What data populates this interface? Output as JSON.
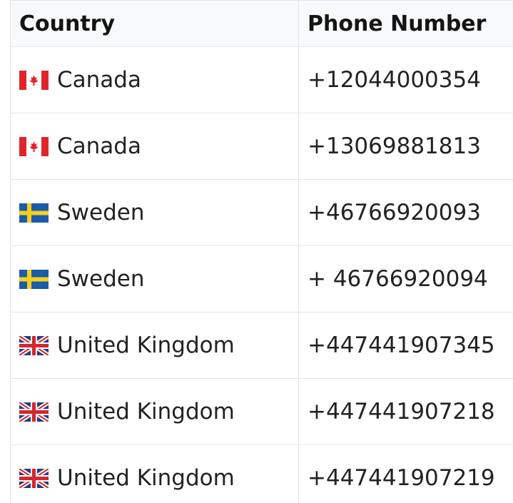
{
  "table": {
    "headers": {
      "country": "Country",
      "phone": "Phone Number"
    },
    "rows": [
      {
        "flag": "canada-flag-icon",
        "country": "Canada",
        "phone": "+12044000354"
      },
      {
        "flag": "canada-flag-icon",
        "country": "Canada",
        "phone": "+13069881813"
      },
      {
        "flag": "sweden-flag-icon",
        "country": "Sweden",
        "phone": "+46766920093"
      },
      {
        "flag": "sweden-flag-icon",
        "country": "Sweden",
        "phone": "+ 46766920094"
      },
      {
        "flag": "uk-flag-icon",
        "country": "United Kingdom",
        "phone": "+447441907345"
      },
      {
        "flag": "uk-flag-icon",
        "country": "United Kingdom",
        "phone": "+447441907218"
      },
      {
        "flag": "uk-flag-icon",
        "country": "United Kingdom",
        "phone": "+447441907219"
      }
    ]
  },
  "colors": {
    "canada_red": "#e1242b",
    "sweden_blue": "#1b5ca8",
    "sweden_yellow": "#f7cf1d",
    "uk_blue": "#2b3a7a",
    "uk_red": "#d3262f",
    "border": "#e3e6ea",
    "header_bg": "#f8f9fa"
  }
}
